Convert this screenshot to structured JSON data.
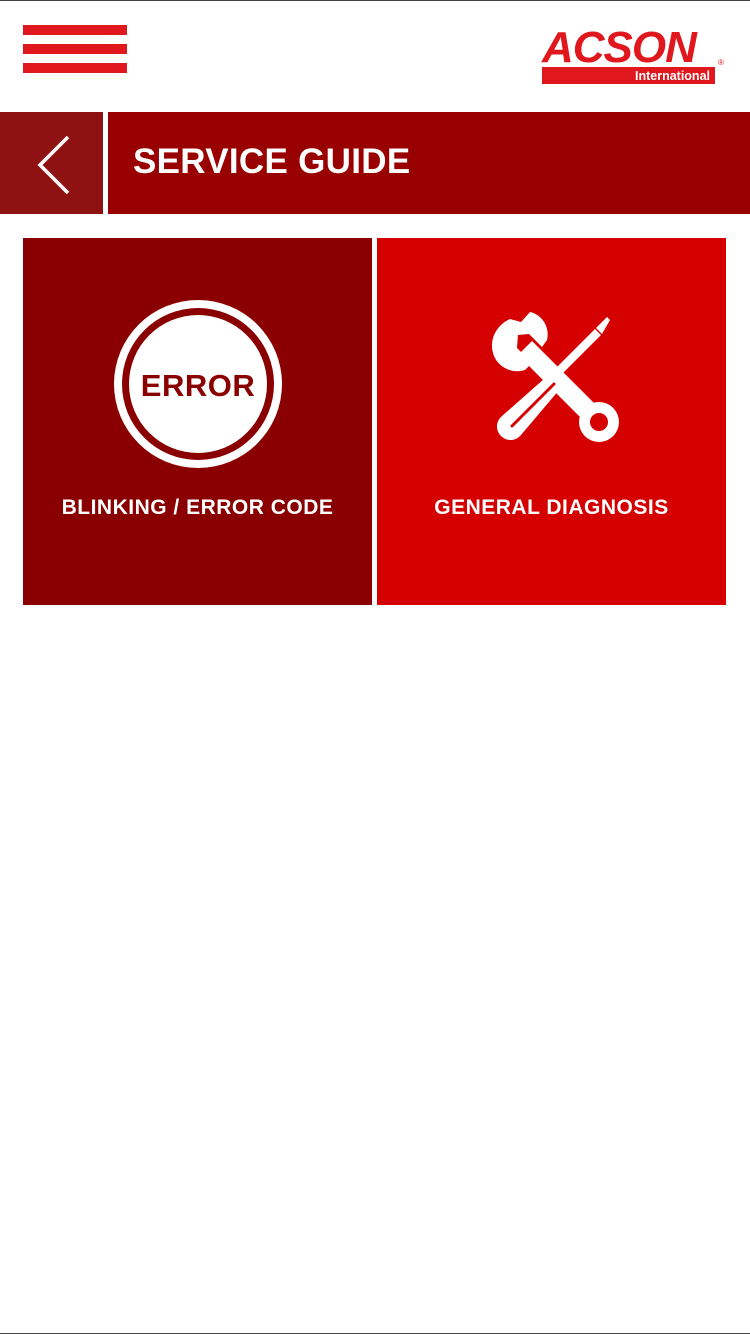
{
  "header": {
    "menu_icon": "hamburger-menu-icon",
    "logo": {
      "brand": "ACSON",
      "sub": "International",
      "registered": "®",
      "brand_color": "#e0171d"
    },
    "back_icon": "chevron-left-icon",
    "title": "SERVICE GUIDE"
  },
  "colors": {
    "title_band": "#990000",
    "back_button": "#8e1212",
    "tile_error": "#8a0000",
    "tile_diagnosis": "#d50000",
    "menu_bars": "#e0171d"
  },
  "tiles": [
    {
      "icon": "error-badge-icon",
      "icon_text": "ERROR",
      "label": "BLINKING / ERROR CODE"
    },
    {
      "icon": "wrench-screwdriver-icon",
      "label": "GENERAL DIAGNOSIS"
    }
  ]
}
